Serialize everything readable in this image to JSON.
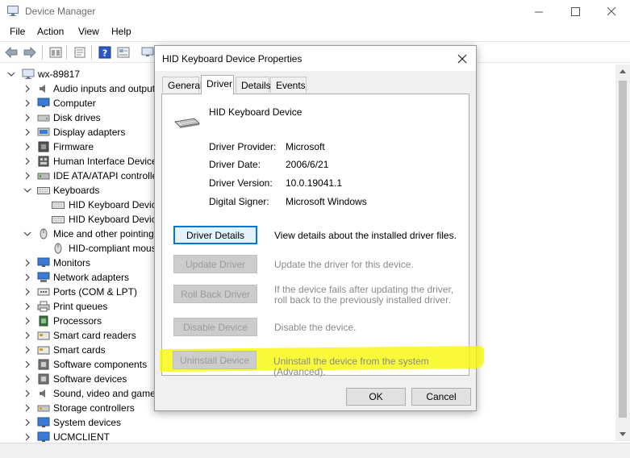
{
  "window": {
    "title": "Device Manager"
  },
  "menu": [
    {
      "label": "File"
    },
    {
      "label": "Action"
    },
    {
      "label": "View"
    },
    {
      "label": "Help"
    }
  ],
  "toolbar": {
    "buttons": [
      "back-icon",
      "forward-icon",
      "properties-icon",
      "update-driver-icon",
      "help-icon",
      "show-hidden-icon",
      "computer-icon"
    ]
  },
  "tree": {
    "root": "wx-89817",
    "items": [
      {
        "label": "Audio inputs and outputs",
        "icon": "speaker-icon",
        "expanded": false
      },
      {
        "label": "Computer",
        "icon": "monitor-icon",
        "expanded": false
      },
      {
        "label": "Disk drives",
        "icon": "disk-icon",
        "expanded": false
      },
      {
        "label": "Display adapters",
        "icon": "display-adapter-icon",
        "expanded": false
      },
      {
        "label": "Firmware",
        "icon": "firmware-icon",
        "expanded": false
      },
      {
        "label": "Human Interface Devices",
        "icon": "hid-icon",
        "expanded": false
      },
      {
        "label": "IDE ATA/ATAPI controllers",
        "icon": "ide-icon",
        "expanded": false
      },
      {
        "label": "Keyboards",
        "icon": "keyboard-icon",
        "expanded": true
      },
      {
        "label": "HID Keyboard Device",
        "icon": "keyboard-icon",
        "child": true
      },
      {
        "label": "HID Keyboard Device",
        "icon": "keyboard-icon",
        "child": true
      },
      {
        "label": "Mice and other pointing devices",
        "icon": "mouse-icon",
        "expanded": true
      },
      {
        "label": "HID-compliant mouse",
        "icon": "mouse-icon",
        "child": true
      },
      {
        "label": "Monitors",
        "icon": "monitor-icon",
        "expanded": false
      },
      {
        "label": "Network adapters",
        "icon": "network-icon",
        "expanded": false
      },
      {
        "label": "Ports (COM & LPT)",
        "icon": "port-icon",
        "expanded": false
      },
      {
        "label": "Print queues",
        "icon": "printer-icon",
        "expanded": false
      },
      {
        "label": "Processors",
        "icon": "processor-icon",
        "expanded": false
      },
      {
        "label": "Smart card readers",
        "icon": "smart-card-icon",
        "expanded": false
      },
      {
        "label": "Smart cards",
        "icon": "smart-card-icon",
        "expanded": false
      },
      {
        "label": "Software components",
        "icon": "software-icon",
        "expanded": false
      },
      {
        "label": "Software devices",
        "icon": "software-icon",
        "expanded": false
      },
      {
        "label": "Sound, video and game controllers",
        "icon": "speaker-icon",
        "expanded": false
      },
      {
        "label": "Storage controllers",
        "icon": "storage-icon",
        "expanded": false
      },
      {
        "label": "System devices",
        "icon": "system-icon",
        "expanded": false
      },
      {
        "label": "UCMCLIENT",
        "icon": "system-icon",
        "expanded": false
      }
    ]
  },
  "dialog": {
    "title": "HID Keyboard Device Properties",
    "tabs": [
      "General",
      "Driver",
      "Details",
      "Events"
    ],
    "active_tab": "Driver",
    "device_name": "HID Keyboard Device",
    "properties": [
      {
        "label": "Driver Provider:",
        "value": "Microsoft"
      },
      {
        "label": "Driver Date:",
        "value": "2006/6/21"
      },
      {
        "label": "Driver Version:",
        "value": "10.0.19041.1"
      },
      {
        "label": "Digital Signer:",
        "value": "Microsoft Windows"
      }
    ],
    "actions": [
      {
        "label": "Driver Details",
        "desc": "View details about the installed driver files.",
        "enabled": true
      },
      {
        "label": "Update Driver",
        "desc": "Update the driver for this device.",
        "enabled": false
      },
      {
        "label": "Roll Back Driver",
        "desc": "If the device fails after updating the driver, roll back to the previously installed driver.",
        "enabled": false
      },
      {
        "label": "Disable Device",
        "desc": "Disable the device.",
        "enabled": false
      },
      {
        "label": "Uninstall Device",
        "desc": "Uninstall the device from the system (Advanced).",
        "enabled": false
      }
    ],
    "ok_label": "OK",
    "cancel_label": "Cancel"
  },
  "colors": {
    "accent": "#0078d7",
    "highlight": "#f6f700"
  }
}
